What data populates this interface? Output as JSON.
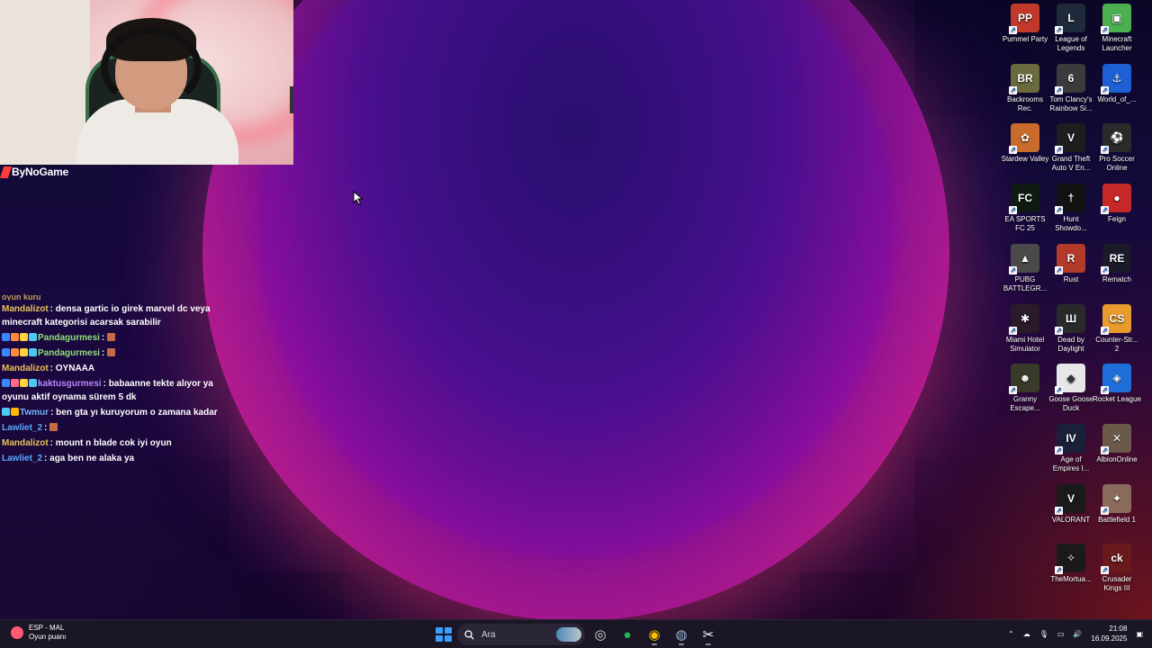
{
  "webcam": {
    "channel_name": "ByNoGame"
  },
  "chat": {
    "cut_line": "oyun kuru",
    "messages": [
      {
        "user": "Mandalizot",
        "color": "#e8c25a",
        "badges": [],
        "text": "densa gartic io girek marvel dc veya minecraft kategorisi acarsak sarabilir",
        "emote": false
      },
      {
        "user": "Pandagurmesi",
        "color": "#8fe07a",
        "badges": [
          "#3a86ff",
          "#ff8c42",
          "#ffd23f",
          "#4cc9f0"
        ],
        "text": "",
        "emote": true
      },
      {
        "user": "Pandagurmesi",
        "color": "#8fe07a",
        "badges": [
          "#3a86ff",
          "#ff8c42",
          "#ffd23f",
          "#4cc9f0"
        ],
        "text": "",
        "emote": true
      },
      {
        "user": "Mandalizot",
        "color": "#e8c25a",
        "badges": [],
        "text": "OYNAAA",
        "emote": false
      },
      {
        "user": "kaktusgurmesi",
        "color": "#b987ff",
        "badges": [
          "#3a86ff",
          "#ff6b8b",
          "#ffd23f",
          "#4cc9f0"
        ],
        "text": "babaanne tekte alıyor ya oyunu aktif oynama sürem 5 dk",
        "emote": false
      },
      {
        "user": "Twmur",
        "color": "#6fb7ff",
        "badges": [
          "#4cc9f0",
          "#ffb703"
        ],
        "text": "ben gta yı kuruyorum o zamana kadar",
        "emote": false
      },
      {
        "user": "Lawliet_2",
        "color": "#5aa8ff",
        "badges": [],
        "text": "",
        "emote": true
      },
      {
        "user": "Mandalizot",
        "color": "#e8c25a",
        "badges": [],
        "text": "mount n blade cok iyi oyun",
        "emote": false
      },
      {
        "user": "Lawliet_2",
        "color": "#5aa8ff",
        "badges": [],
        "text": "aga ben ne alaka ya",
        "emote": false
      }
    ]
  },
  "desktop": {
    "icons": [
      {
        "label": "Pummel Party",
        "name": "pummel-party-icon",
        "bg": "#c0392b",
        "glyph": "PP"
      },
      {
        "label": "League of Legends",
        "name": "league-of-legends-icon",
        "bg": "#1f2b3a",
        "glyph": "L"
      },
      {
        "label": "Minecraft Launcher",
        "name": "minecraft-launcher-icon",
        "bg": "#4caf50",
        "glyph": "▣"
      },
      {
        "label": "Backrooms Rec.",
        "name": "backrooms-rec-icon",
        "bg": "#6b6a3f",
        "glyph": "BR"
      },
      {
        "label": "Tom Clancy's Rainbow Si...",
        "name": "rainbow-six-icon",
        "bg": "#3b3b3b",
        "glyph": "6"
      },
      {
        "label": "World_of_...",
        "name": "world-of-warships-icon",
        "bg": "#1e5fd4",
        "glyph": "⚓"
      },
      {
        "label": "Stardew Valley",
        "name": "stardew-valley-icon",
        "bg": "#c96b2c",
        "glyph": "✿"
      },
      {
        "label": "Grand Theft Auto V En...",
        "name": "gta-v-icon",
        "bg": "#1e1e1e",
        "glyph": "V"
      },
      {
        "label": "Pro Soccer Online",
        "name": "pro-soccer-online-icon",
        "bg": "#2a2a2a",
        "glyph": "⚽"
      },
      {
        "label": "EA SPORTS FC 25",
        "name": "ea-sports-fc25-icon",
        "bg": "#0e1a12",
        "glyph": "FC"
      },
      {
        "label": "Hunt Showdo...",
        "name": "hunt-showdown-icon",
        "bg": "#121212",
        "glyph": "†"
      },
      {
        "label": "Feign",
        "name": "feign-icon",
        "bg": "#c62828",
        "glyph": "●"
      },
      {
        "label": "PUBG BATTLEGR...",
        "name": "pubg-icon",
        "bg": "#4a4a4a",
        "glyph": "▲"
      },
      {
        "label": "Rust",
        "name": "rust-icon",
        "bg": "#b23a2a",
        "glyph": "R"
      },
      {
        "label": "Rematch",
        "name": "rematch-icon",
        "bg": "#1a1a2a",
        "glyph": "RE"
      },
      {
        "label": "Miami Hotel Simulator",
        "name": "miami-hotel-simulator-icon",
        "bg": "#2a1a2a",
        "glyph": "✱"
      },
      {
        "label": "Dead by Daylight",
        "name": "dead-by-daylight-icon",
        "bg": "#2a2a2a",
        "glyph": "Ш"
      },
      {
        "label": "Counter-Str... 2",
        "name": "counter-strike-2-icon",
        "bg": "#e89a2c",
        "glyph": "CS"
      },
      {
        "label": "Granny Escape...",
        "name": "granny-escape-icon",
        "bg": "#3a3a2a",
        "glyph": "☻"
      },
      {
        "label": "Goose Goose Duck",
        "name": "goose-goose-duck-icon",
        "bg": "#e6e6e6",
        "glyph": "◆"
      },
      {
        "label": "Rocket League",
        "name": "rocket-league-icon",
        "bg": "#1e6fd9",
        "glyph": "◈"
      },
      {
        "label": "Age of Empires I...",
        "name": "age-of-empires-icon",
        "bg": "#1a1f3a",
        "glyph": "IV"
      },
      {
        "label": "AlbionOnline",
        "name": "albion-online-icon",
        "bg": "#6b5a4a",
        "glyph": "✕"
      },
      {
        "label": "VALORANT",
        "name": "valorant-icon",
        "bg": "#1a1a1a",
        "glyph": "V"
      },
      {
        "label": "Battlefield 1",
        "name": "battlefield-1-icon",
        "bg": "#8a6a5a",
        "glyph": "✦"
      },
      {
        "label": "TheMortua...",
        "name": "the-mortuary-icon",
        "bg": "#1a1a1a",
        "glyph": "✧"
      },
      {
        "label": "Crusader Kings III",
        "name": "crusader-kings-iii-icon",
        "bg": "#6a1a1a",
        "glyph": "ck"
      }
    ]
  },
  "taskbar": {
    "widget_title": "ESP - MAL",
    "widget_subtitle": "Oyun puanı",
    "search_placeholder": "Ara",
    "time": "21:08",
    "date": "16.09.2025",
    "apps": [
      {
        "name": "obs-studio-icon",
        "glyph": "◎",
        "color": "#ddd",
        "active": false
      },
      {
        "name": "spotify-icon",
        "glyph": "●",
        "color": "#1db954",
        "active": false
      },
      {
        "name": "chrome-icon",
        "glyph": "◉",
        "color": "#fbbc05",
        "active": true
      },
      {
        "name": "steam-icon",
        "glyph": "◍",
        "color": "#9ab4d4",
        "active": true
      },
      {
        "name": "capcut-icon",
        "glyph": "✂",
        "color": "#fff",
        "active": true
      }
    ]
  }
}
